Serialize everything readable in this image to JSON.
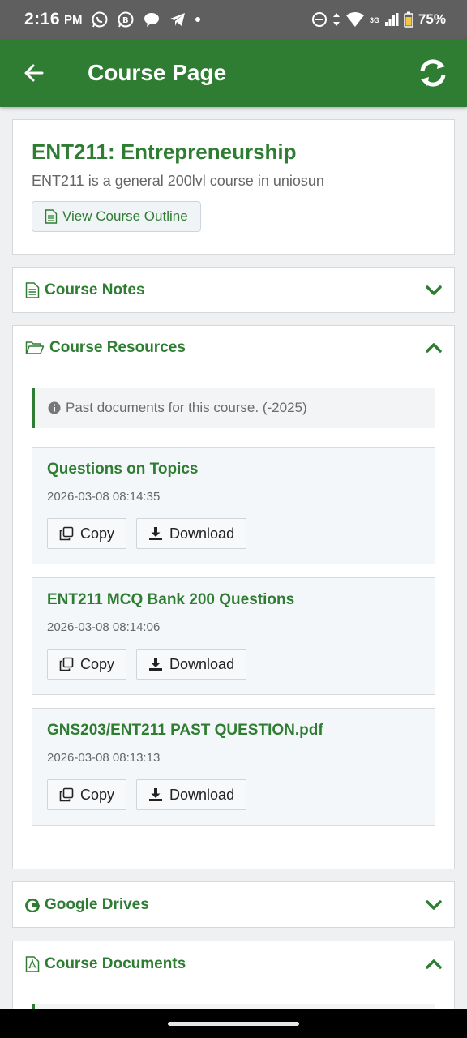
{
  "status_bar": {
    "time": "2:16",
    "ampm": "PM",
    "network": "3G",
    "battery": "75%"
  },
  "app_bar": {
    "title": "Course Page"
  },
  "course": {
    "title": "ENT211: Entrepreneurship",
    "description": "ENT211 is a general 200lvl course in uniosun",
    "outline_button": "View Course Outline"
  },
  "sections": {
    "notes": {
      "label": "Course Notes"
    },
    "resources": {
      "label": "Course Resources",
      "info": "Past documents for this course. (-2025)",
      "items": [
        {
          "title": "Questions on Topics",
          "date": "2026-03-08 08:14:35",
          "copy_label": "Copy",
          "download_label": "Download"
        },
        {
          "title": "ENT211 MCQ Bank 200 Questions",
          "date": "2026-03-08 08:14:06",
          "copy_label": "Copy",
          "download_label": "Download"
        },
        {
          "title": "GNS203/ENT211 PAST QUESTION.pdf",
          "date": "2026-03-08 08:13:13",
          "copy_label": "Copy",
          "download_label": "Download"
        }
      ]
    },
    "drives": {
      "label": "Google Drives"
    },
    "documents": {
      "label": "Course Documents"
    }
  },
  "colors": {
    "primary": "#2e7d32",
    "status_bar": "#5f5f5f"
  }
}
